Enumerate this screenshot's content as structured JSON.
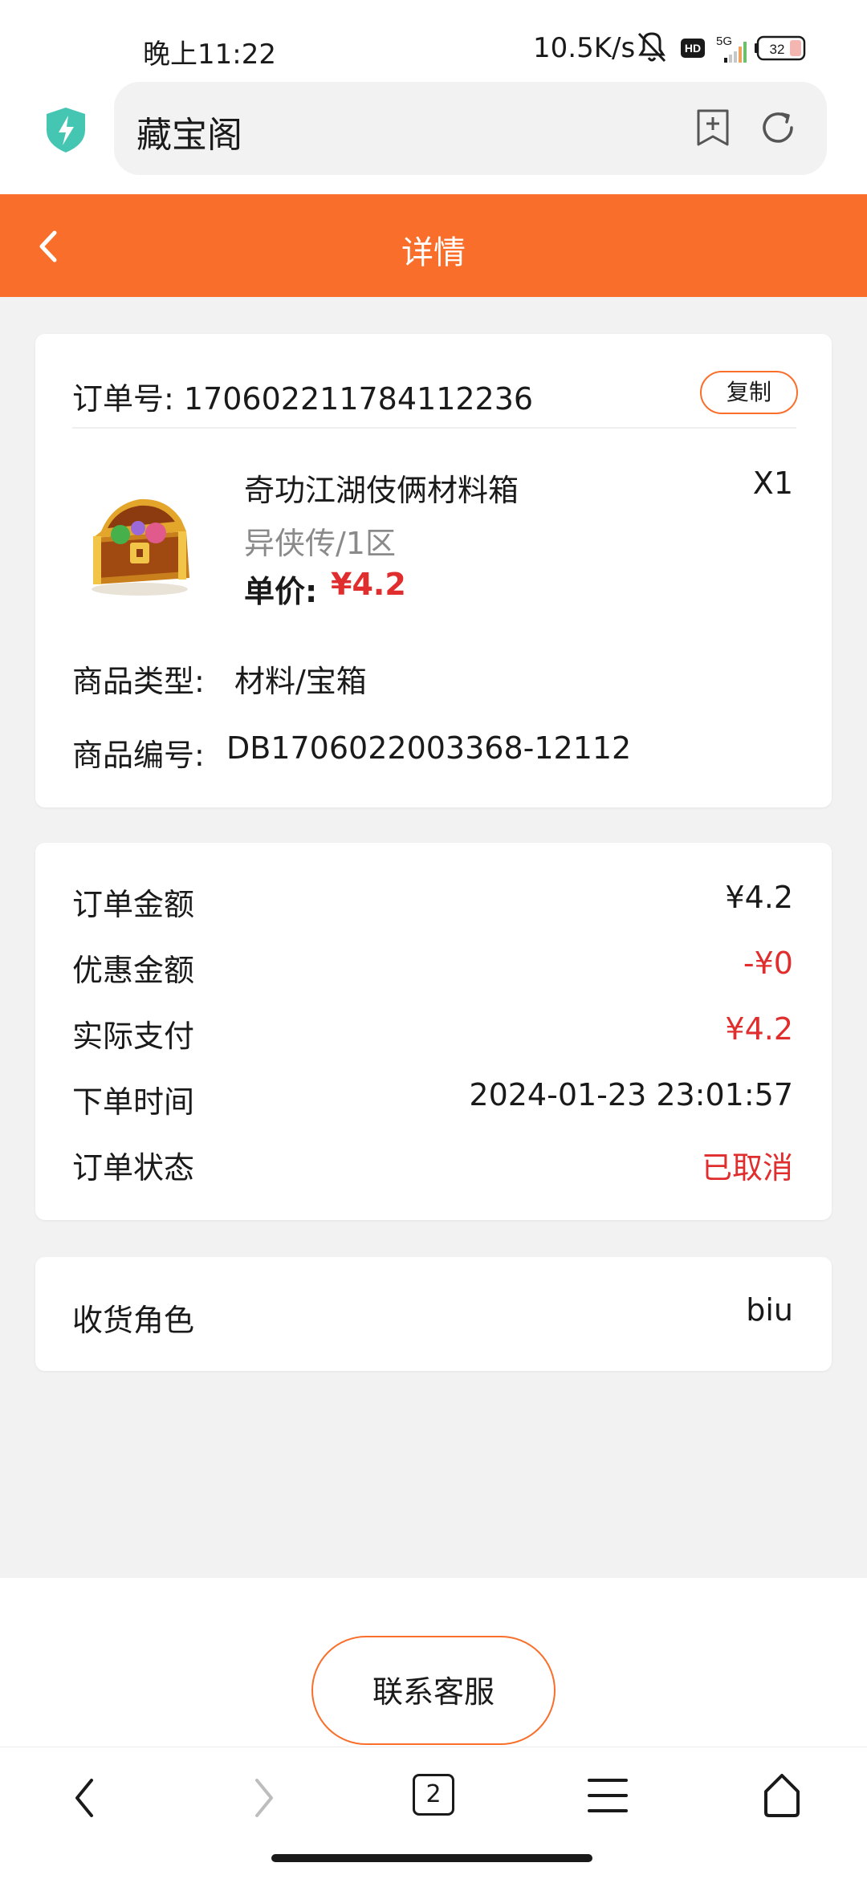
{
  "status_bar": {
    "time": "晚上11:22",
    "network_speed": "10.5K/s",
    "hd_badge": "HD",
    "network_type": "5G",
    "battery": "32"
  },
  "browser": {
    "title": "藏宝阁"
  },
  "header": {
    "title": "详情"
  },
  "order": {
    "number_label": "订单号:",
    "number_value": "170602211784112236",
    "copy_label": "复制",
    "product": {
      "name": "奇功江湖伎俩材料箱",
      "quantity": "X1",
      "server": "异侠传/1区",
      "unit_price_label": "单价:",
      "unit_price_value": "¥4.2"
    },
    "type_label": "商品类型:",
    "type_value": "材料/宝箱",
    "code_label": "商品编号:",
    "code_value": "DB1706022003368-12112"
  },
  "amounts": [
    {
      "label": "订单金额",
      "value": "¥4.2"
    },
    {
      "label": "优惠金额",
      "value": "-¥0"
    },
    {
      "label": "实际支付",
      "value": "¥4.2"
    },
    {
      "label": "下单时间",
      "value": "2024-01-23 23:01:57"
    },
    {
      "label": "订单状态",
      "value": "已取消"
    }
  ],
  "recipient": {
    "label": "收货角色",
    "value": "biu"
  },
  "contact_button": "联系客服",
  "tabs_count": "2",
  "colors": {
    "accent": "#f96e2a",
    "price_red": "#e02d2d",
    "background": "#f2f2f2"
  }
}
